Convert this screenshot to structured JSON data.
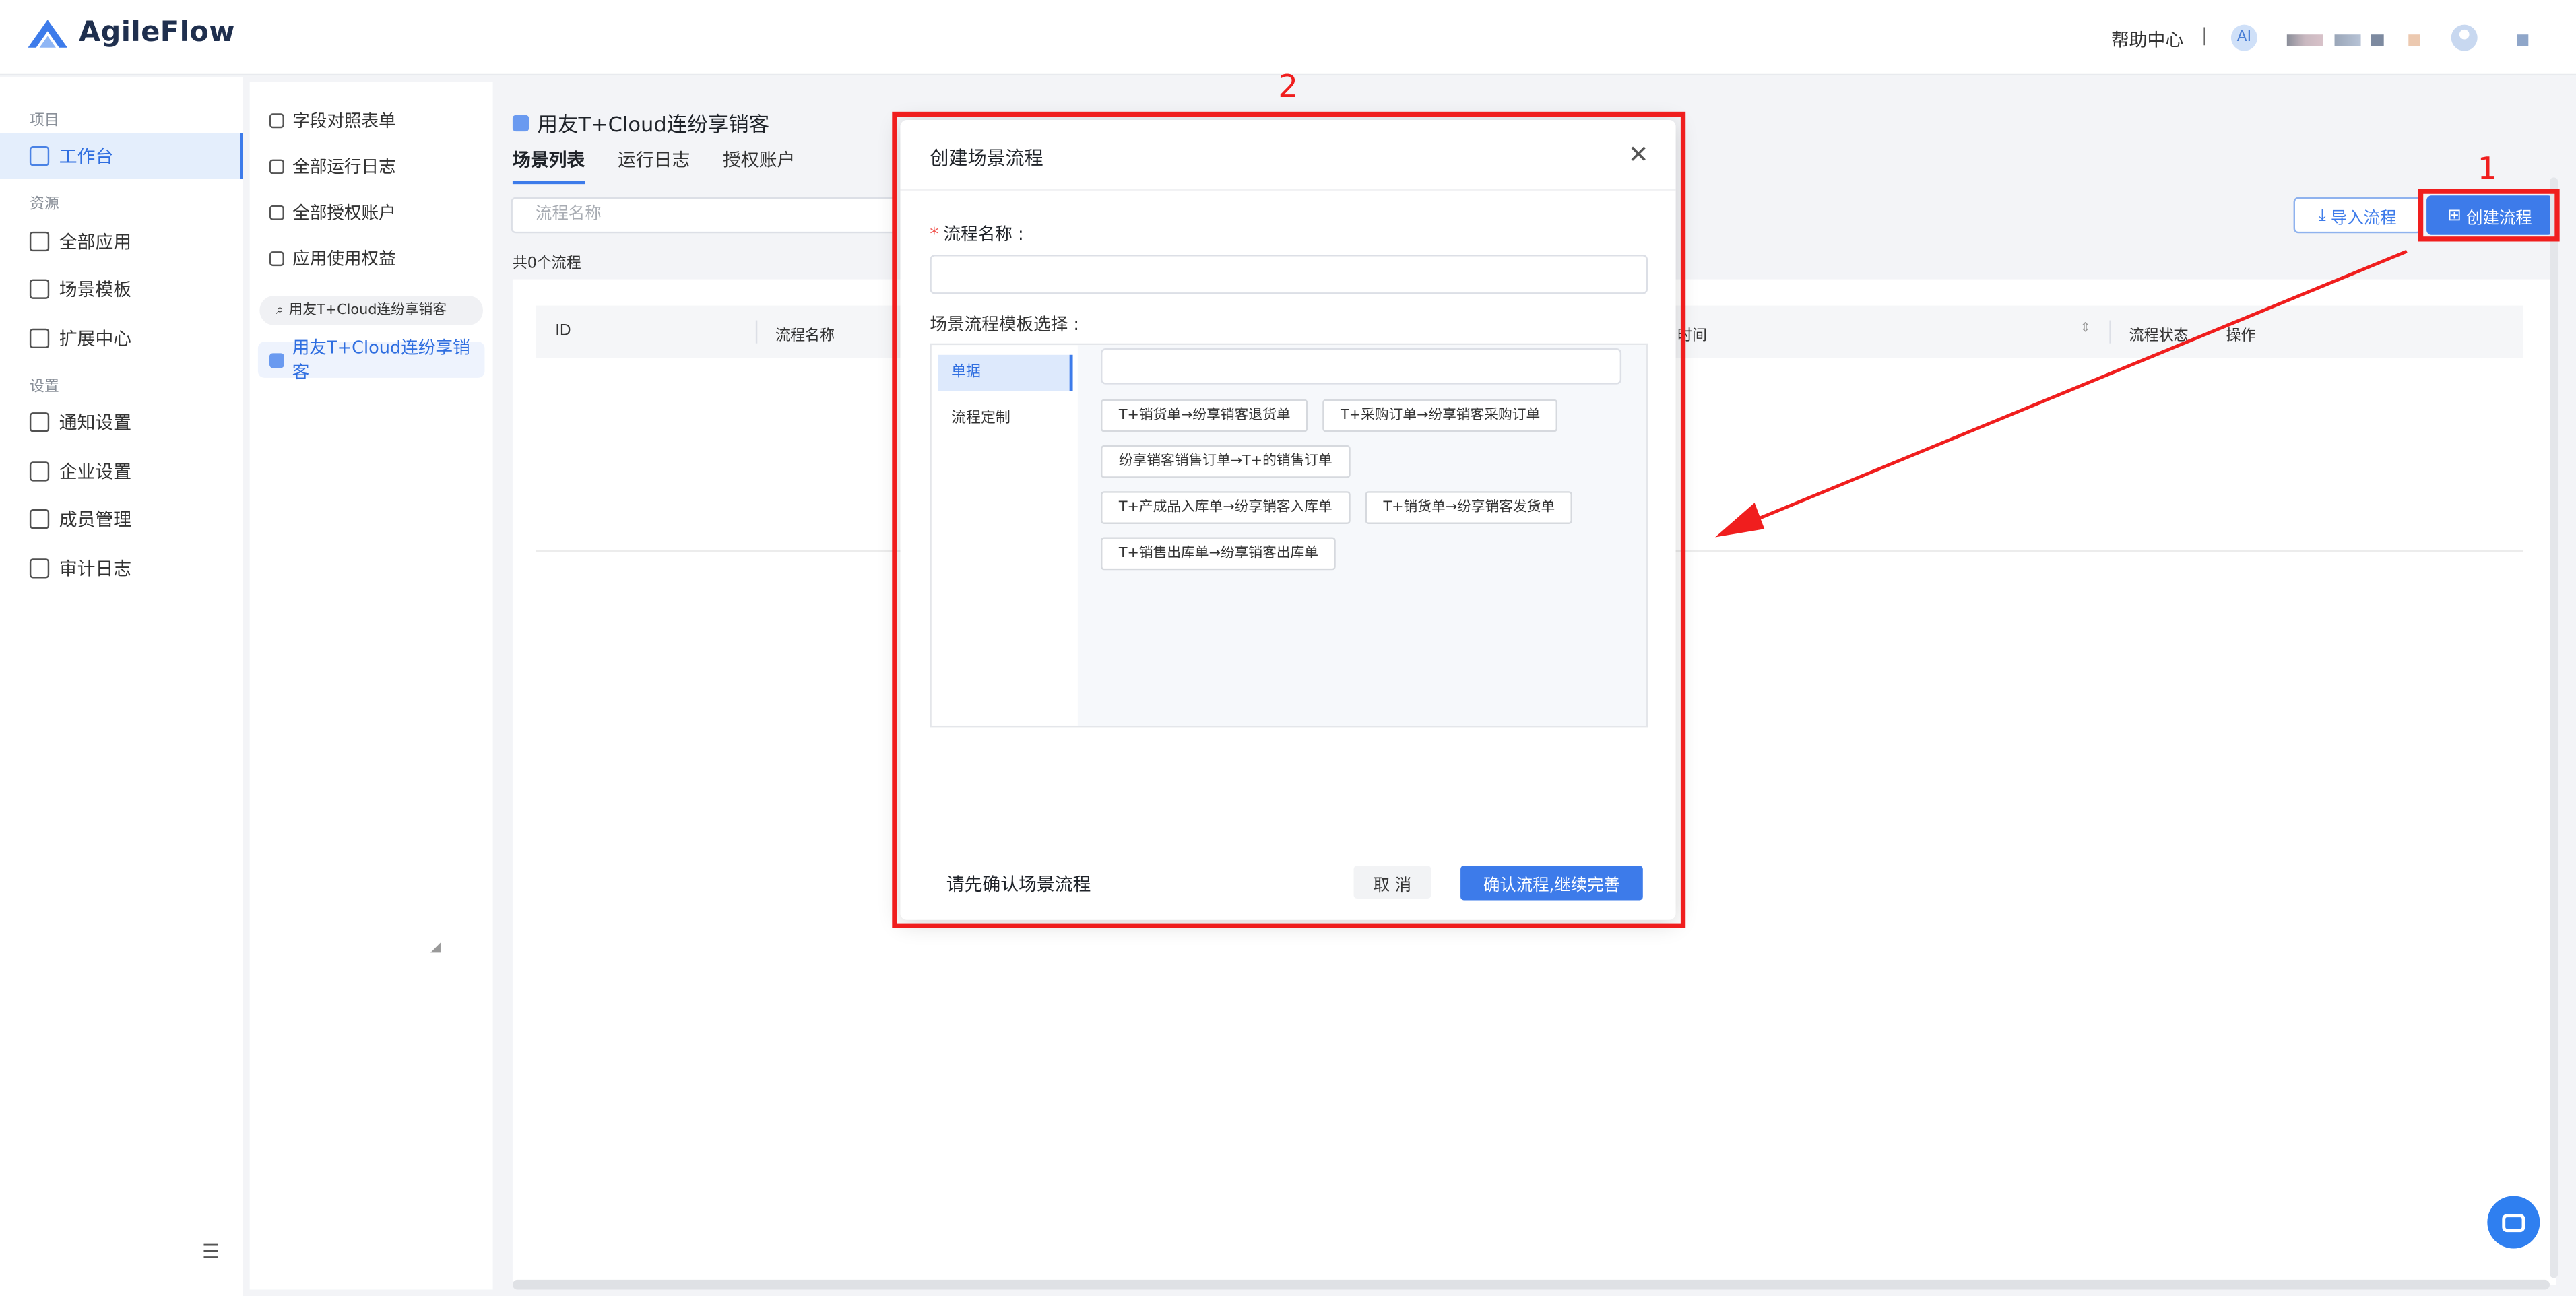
{
  "app": {
    "logo_text": "AgileFlow",
    "help_center": "帮助中心",
    "separator": "|",
    "badge_text": "AI"
  },
  "sidebar": {
    "sections": [
      {
        "label": "项目"
      },
      {
        "label": "资源"
      },
      {
        "label": "设置"
      }
    ],
    "items": [
      {
        "label": "工作台",
        "icon": "dashboard-icon"
      },
      {
        "label": "全部应用",
        "icon": "grid-icon"
      },
      {
        "label": "场景模板",
        "icon": "template-icon"
      },
      {
        "label": "扩展中心",
        "icon": "puzzle-icon"
      },
      {
        "label": "通知设置",
        "icon": "notification-icon"
      },
      {
        "label": "企业设置",
        "icon": "enterprise-icon"
      },
      {
        "label": "成员管理",
        "icon": "members-icon"
      },
      {
        "label": "审计日志",
        "icon": "audit-icon"
      }
    ],
    "collapse_glyph": "☰"
  },
  "panel2": {
    "items": [
      {
        "label": "字段对照表单"
      },
      {
        "label": "全部运行日志"
      },
      {
        "label": "全部授权账户"
      },
      {
        "label": "应用使用权益"
      }
    ],
    "search_value": "用友T+Cloud连纷享销客",
    "active_item": "用友T+Cloud连纷享销客"
  },
  "main": {
    "title": "用友T+Cloud连纷享销客",
    "tabs": [
      {
        "label": "场景列表",
        "active": true
      },
      {
        "label": "运行日志",
        "active": false
      },
      {
        "label": "授权账户",
        "active": false
      }
    ],
    "search_placeholder": "流程名称",
    "count_text": "共0个流程",
    "import_button": "导入流程",
    "create_button": "创建流程",
    "table_headers": [
      "ID",
      "流程名称",
      "时间",
      "流程状态",
      "操作"
    ]
  },
  "dialog": {
    "title": "创建场景流程",
    "name_label": "流程名称 :",
    "required_mark": "*",
    "name_value": "",
    "template_label": "场景流程模板选择 :",
    "categories": [
      {
        "label": "单据",
        "active": true
      },
      {
        "label": "流程定制",
        "active": false
      }
    ],
    "template_search_value": "",
    "templates": [
      "T+销货单→纷享销客退货单",
      "T+采购订单→纷享销客采购订单",
      "纷享销客销售订单→T+的销售订单",
      "T+产成品入库单→纷享销客入库单",
      "T+销货单→纷享销客发货单",
      "T+销售出库单→纷享销客出库单"
    ],
    "status_text": "请先确认场景流程",
    "cancel_button": "取 消",
    "confirm_button": "确认流程,继续完善"
  },
  "annotations": {
    "label_1": "1",
    "label_2": "2",
    "color": "#f01e1e"
  },
  "colors": {
    "accent": "#3d7bea",
    "annotation": "#f01e1e"
  }
}
